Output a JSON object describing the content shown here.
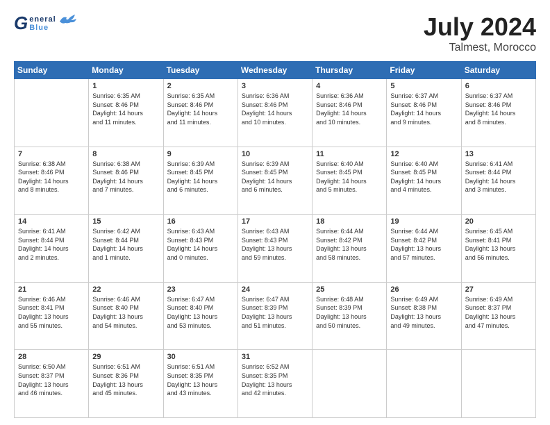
{
  "header": {
    "logo_g": "G",
    "logo_line1": "eneral",
    "logo_line2": "Blue",
    "main_title": "July 2024",
    "sub_title": "Talmest, Morocco"
  },
  "calendar": {
    "days_of_week": [
      "Sunday",
      "Monday",
      "Tuesday",
      "Wednesday",
      "Thursday",
      "Friday",
      "Saturday"
    ],
    "weeks": [
      [
        {
          "day": "",
          "info": ""
        },
        {
          "day": "1",
          "info": "Sunrise: 6:35 AM\nSunset: 8:46 PM\nDaylight: 14 hours\nand 11 minutes."
        },
        {
          "day": "2",
          "info": "Sunrise: 6:35 AM\nSunset: 8:46 PM\nDaylight: 14 hours\nand 11 minutes."
        },
        {
          "day": "3",
          "info": "Sunrise: 6:36 AM\nSunset: 8:46 PM\nDaylight: 14 hours\nand 10 minutes."
        },
        {
          "day": "4",
          "info": "Sunrise: 6:36 AM\nSunset: 8:46 PM\nDaylight: 14 hours\nand 10 minutes."
        },
        {
          "day": "5",
          "info": "Sunrise: 6:37 AM\nSunset: 8:46 PM\nDaylight: 14 hours\nand 9 minutes."
        },
        {
          "day": "6",
          "info": "Sunrise: 6:37 AM\nSunset: 8:46 PM\nDaylight: 14 hours\nand 8 minutes."
        }
      ],
      [
        {
          "day": "7",
          "info": "Sunrise: 6:38 AM\nSunset: 8:46 PM\nDaylight: 14 hours\nand 8 minutes."
        },
        {
          "day": "8",
          "info": "Sunrise: 6:38 AM\nSunset: 8:46 PM\nDaylight: 14 hours\nand 7 minutes."
        },
        {
          "day": "9",
          "info": "Sunrise: 6:39 AM\nSunset: 8:45 PM\nDaylight: 14 hours\nand 6 minutes."
        },
        {
          "day": "10",
          "info": "Sunrise: 6:39 AM\nSunset: 8:45 PM\nDaylight: 14 hours\nand 6 minutes."
        },
        {
          "day": "11",
          "info": "Sunrise: 6:40 AM\nSunset: 8:45 PM\nDaylight: 14 hours\nand 5 minutes."
        },
        {
          "day": "12",
          "info": "Sunrise: 6:40 AM\nSunset: 8:45 PM\nDaylight: 14 hours\nand 4 minutes."
        },
        {
          "day": "13",
          "info": "Sunrise: 6:41 AM\nSunset: 8:44 PM\nDaylight: 14 hours\nand 3 minutes."
        }
      ],
      [
        {
          "day": "14",
          "info": "Sunrise: 6:41 AM\nSunset: 8:44 PM\nDaylight: 14 hours\nand 2 minutes."
        },
        {
          "day": "15",
          "info": "Sunrise: 6:42 AM\nSunset: 8:44 PM\nDaylight: 14 hours\nand 1 minute."
        },
        {
          "day": "16",
          "info": "Sunrise: 6:43 AM\nSunset: 8:43 PM\nDaylight: 14 hours\nand 0 minutes."
        },
        {
          "day": "17",
          "info": "Sunrise: 6:43 AM\nSunset: 8:43 PM\nDaylight: 13 hours\nand 59 minutes."
        },
        {
          "day": "18",
          "info": "Sunrise: 6:44 AM\nSunset: 8:42 PM\nDaylight: 13 hours\nand 58 minutes."
        },
        {
          "day": "19",
          "info": "Sunrise: 6:44 AM\nSunset: 8:42 PM\nDaylight: 13 hours\nand 57 minutes."
        },
        {
          "day": "20",
          "info": "Sunrise: 6:45 AM\nSunset: 8:41 PM\nDaylight: 13 hours\nand 56 minutes."
        }
      ],
      [
        {
          "day": "21",
          "info": "Sunrise: 6:46 AM\nSunset: 8:41 PM\nDaylight: 13 hours\nand 55 minutes."
        },
        {
          "day": "22",
          "info": "Sunrise: 6:46 AM\nSunset: 8:40 PM\nDaylight: 13 hours\nand 54 minutes."
        },
        {
          "day": "23",
          "info": "Sunrise: 6:47 AM\nSunset: 8:40 PM\nDaylight: 13 hours\nand 53 minutes."
        },
        {
          "day": "24",
          "info": "Sunrise: 6:47 AM\nSunset: 8:39 PM\nDaylight: 13 hours\nand 51 minutes."
        },
        {
          "day": "25",
          "info": "Sunrise: 6:48 AM\nSunset: 8:39 PM\nDaylight: 13 hours\nand 50 minutes."
        },
        {
          "day": "26",
          "info": "Sunrise: 6:49 AM\nSunset: 8:38 PM\nDaylight: 13 hours\nand 49 minutes."
        },
        {
          "day": "27",
          "info": "Sunrise: 6:49 AM\nSunset: 8:37 PM\nDaylight: 13 hours\nand 47 minutes."
        }
      ],
      [
        {
          "day": "28",
          "info": "Sunrise: 6:50 AM\nSunset: 8:37 PM\nDaylight: 13 hours\nand 46 minutes."
        },
        {
          "day": "29",
          "info": "Sunrise: 6:51 AM\nSunset: 8:36 PM\nDaylight: 13 hours\nand 45 minutes."
        },
        {
          "day": "30",
          "info": "Sunrise: 6:51 AM\nSunset: 8:35 PM\nDaylight: 13 hours\nand 43 minutes."
        },
        {
          "day": "31",
          "info": "Sunrise: 6:52 AM\nSunset: 8:35 PM\nDaylight: 13 hours\nand 42 minutes."
        },
        {
          "day": "",
          "info": ""
        },
        {
          "day": "",
          "info": ""
        },
        {
          "day": "",
          "info": ""
        }
      ]
    ]
  }
}
